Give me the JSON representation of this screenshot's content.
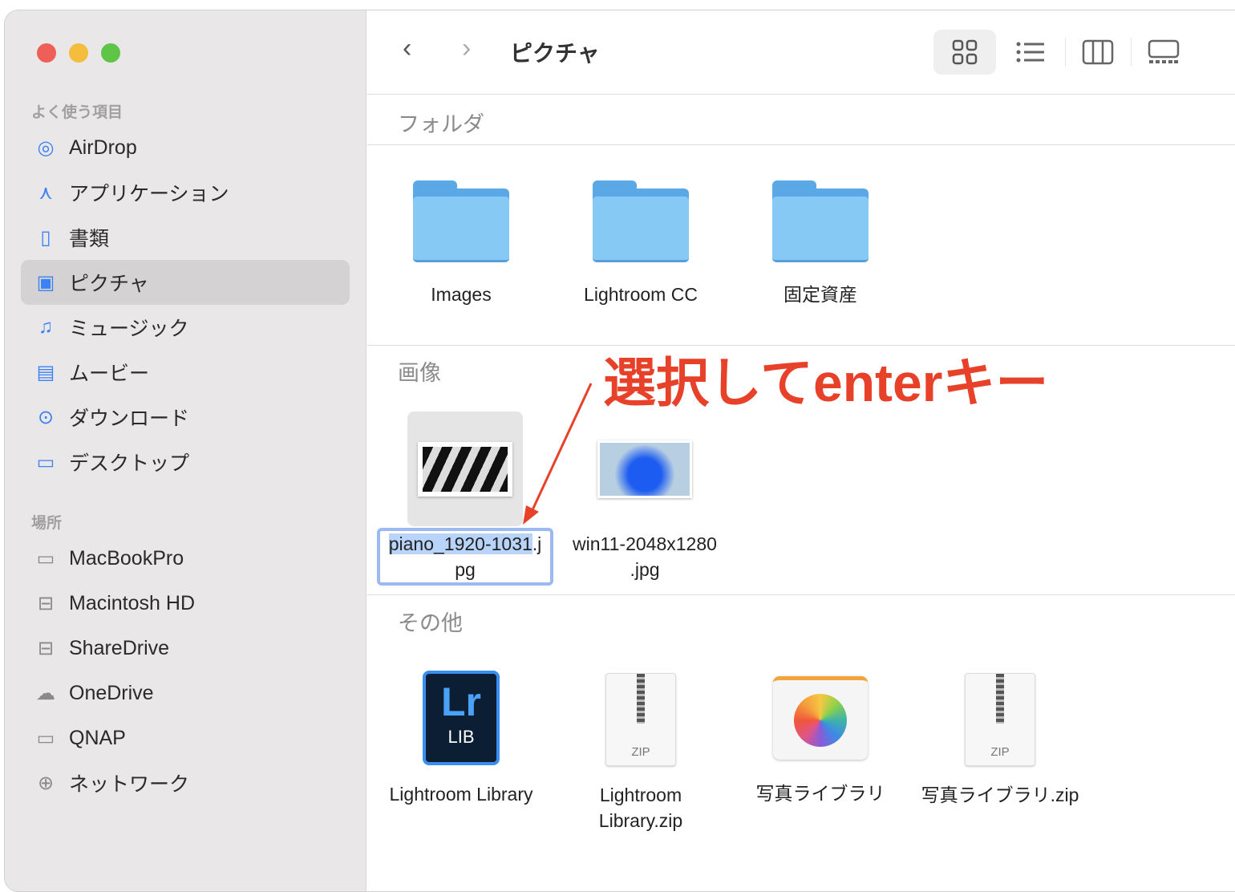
{
  "window": {
    "title": "ピクチャ"
  },
  "sidebar": {
    "favorites_header": "よく使う項目",
    "favorites": [
      {
        "label": "AirDrop",
        "icon": "airdrop-icon"
      },
      {
        "label": "アプリケーション",
        "icon": "applications-icon"
      },
      {
        "label": "書類",
        "icon": "document-icon"
      },
      {
        "label": "ピクチャ",
        "icon": "pictures-icon",
        "selected": true
      },
      {
        "label": "ミュージック",
        "icon": "music-icon"
      },
      {
        "label": "ムービー",
        "icon": "movie-icon"
      },
      {
        "label": "ダウンロード",
        "icon": "download-icon"
      },
      {
        "label": "デスクトップ",
        "icon": "desktop-icon"
      }
    ],
    "locations_header": "場所",
    "locations": [
      {
        "label": "MacBookPro",
        "icon": "laptop-icon"
      },
      {
        "label": "Macintosh HD",
        "icon": "disk-icon"
      },
      {
        "label": "ShareDrive",
        "icon": "disk-icon"
      },
      {
        "label": "OneDrive",
        "icon": "cloud-icon"
      },
      {
        "label": "QNAP",
        "icon": "display-icon"
      },
      {
        "label": "ネットワーク",
        "icon": "network-icon"
      }
    ]
  },
  "toolbar": {
    "back": "‹",
    "forward": "›",
    "views": [
      "icon-view",
      "list-view",
      "column-view",
      "gallery-view"
    ],
    "active_view": "icon-view"
  },
  "sections": {
    "folders": {
      "label": "フォルダ",
      "items": [
        "Images",
        "Lightroom CC",
        "固定資産"
      ]
    },
    "images": {
      "label": "画像",
      "items": [
        {
          "name_selected": "piano_1920-1031",
          "name_rest": ".j",
          "name_line2": "pg",
          "editing": true
        },
        {
          "name": "win11-2048x1280",
          "name_line2": ".jpg"
        }
      ]
    },
    "other": {
      "label": "その他",
      "items": [
        "Lightroom Library",
        "Lightroom\nLibrary.zip",
        "写真ライブラリ",
        "写真ライブラリ.zip"
      ],
      "lr_badge": "Lr",
      "lr_sub": "LIB",
      "zip_label": "ZIP"
    }
  },
  "annotation": {
    "text": "選択してenterキー",
    "color": "#e8412a"
  }
}
